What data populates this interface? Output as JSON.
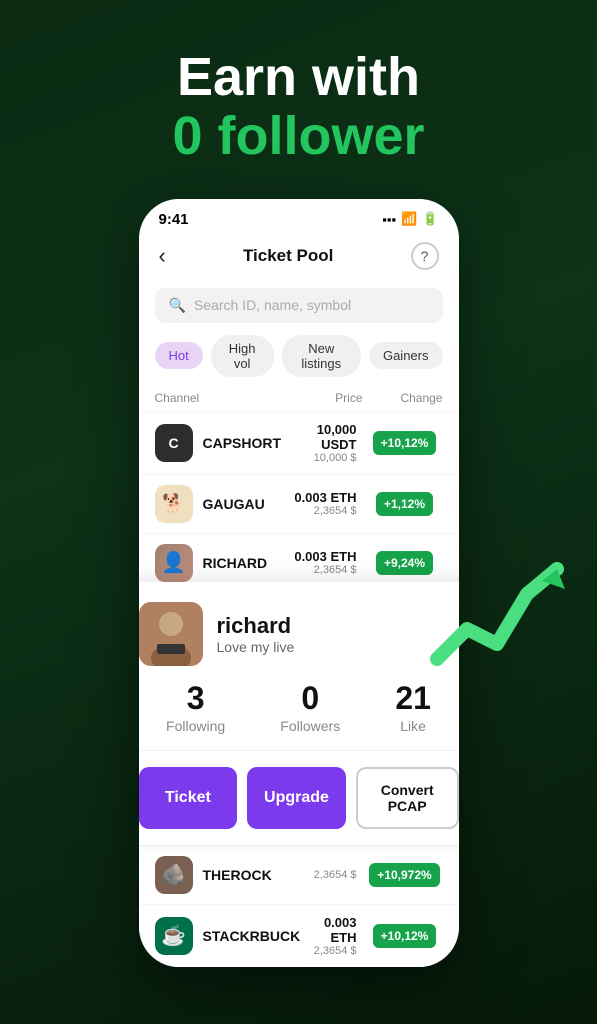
{
  "hero": {
    "line1": "Earn with",
    "line2": "0 follower"
  },
  "phone": {
    "status_time": "9:41",
    "nav_back": "‹",
    "nav_title": "Ticket Pool",
    "nav_help": "?",
    "search_placeholder": "Search ID, name, symbol",
    "filters": [
      {
        "label": "Hot",
        "active": true
      },
      {
        "label": "High vol",
        "active": false
      },
      {
        "label": "New listings",
        "active": false
      },
      {
        "label": "Gainers",
        "active": false
      }
    ],
    "table_headers": {
      "channel": "Channel",
      "price": "Price",
      "change": "Change"
    },
    "tickers": [
      {
        "name": "CAPSHORT",
        "avatar_type": "capshort",
        "avatar_text": "C",
        "price_main": "10,000 USDT",
        "price_usd": "10,000 $",
        "change": "+10,12%"
      },
      {
        "name": "GAUGAU",
        "avatar_type": "gaugau",
        "avatar_text": "🐕",
        "price_main": "0.003 ETH",
        "price_usd": "2,3654 $",
        "change": "+1,12%"
      },
      {
        "name": "RICHARD",
        "avatar_type": "richard",
        "avatar_text": "👤",
        "price_main": "0.003 ETH",
        "price_usd": "2,3654 $",
        "change": "+9,24%"
      },
      {
        "name": "THEROCK",
        "avatar_type": "therock",
        "avatar_text": "🪨",
        "price_main": "",
        "price_usd": "2,3654 $",
        "change": "+10,972%"
      },
      {
        "name": "STACKRBUCK",
        "avatar_type": "starbucks",
        "avatar_text": "☕",
        "price_main": "0.003 ETH",
        "price_usd": "2,3654 $",
        "change": "+10,12%"
      }
    ]
  },
  "profile": {
    "name": "richard",
    "bio": "Love my live",
    "avatar_emoji": "🧑",
    "stats": [
      {
        "number": "3",
        "label": "Following"
      },
      {
        "number": "0",
        "label": "Followers"
      },
      {
        "number": "21",
        "label": "Like"
      }
    ],
    "buttons": {
      "ticket": "Ticket",
      "upgrade": "Upgrade",
      "convert": "Convert PCAP"
    }
  },
  "colors": {
    "green_accent": "#22c55e",
    "purple": "#7c3aed",
    "green_badge": "#16a34a"
  }
}
